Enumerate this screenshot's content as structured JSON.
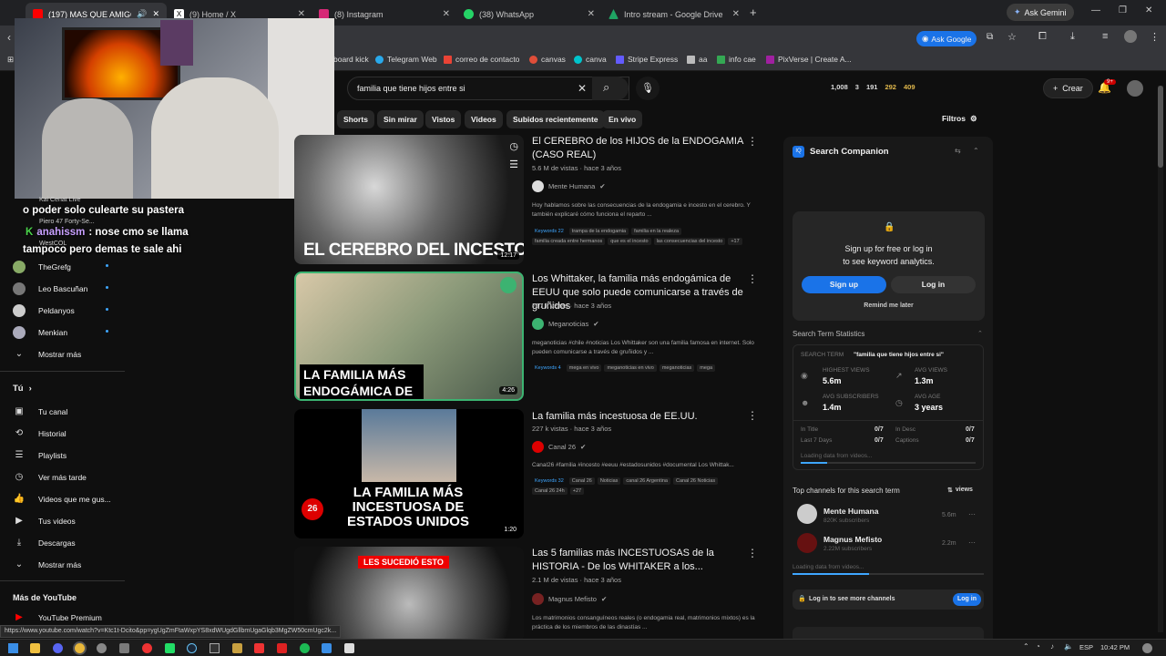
{
  "tabs": [
    {
      "title": "(197) MAS QUE AMIGOS | E",
      "color": "#ff0000"
    },
    {
      "title": "(9) Home / X",
      "color": "#ffffff"
    },
    {
      "title": "(8) Instagram",
      "color": "#d62976"
    },
    {
      "title": "(38) WhatsApp",
      "color": "#25d366"
    },
    {
      "title": "Intro stream - Google Drive",
      "color": "#1fa463"
    }
  ],
  "browser": {
    "ask_gemini": "Ask Gemini",
    "ask_google": "Ask Google"
  },
  "bookmarks": [
    "board kick",
    "Telegram Web",
    "correo de contacto",
    "canvas",
    "canva",
    "Stripe Express",
    "aa",
    "info cae",
    "PixVerse | Create A..."
  ],
  "search": {
    "query": "familia que tiene hijos entre si"
  },
  "header": {
    "stats": [
      "1,008",
      "3",
      "191",
      "292",
      "409"
    ],
    "create_label": "Crear",
    "notif_badge": "9+"
  },
  "chips": [
    "Shorts",
    "Sin mirar",
    "Vistos",
    "Videos",
    "Subidos recientemente",
    "En vivo"
  ],
  "filters_label": "Filtros",
  "chat": {
    "line1": "o poder solo culearte su pastera",
    "user2": "anahissm",
    "line2": ": nose cmo se llama",
    "line3": "tampoco pero demas te sale ahi",
    "under1": "Kai Cenat Live",
    "under2": "Piero 47 Forty-Se...",
    "under3": "WestCOL"
  },
  "sidebar": {
    "subs": [
      "TheGrefg",
      "Leo Bascuñan",
      "Peldanyos",
      "Menkian"
    ],
    "show_more": "Mostrar más",
    "you_label": "Tú",
    "you_items": [
      "Tu canal",
      "Historial",
      "Playlists",
      "Ver más tarde",
      "Videos que me gus...",
      "Tus videos",
      "Descargas",
      "Mostrar más"
    ],
    "more_label": "Más de YouTube",
    "premium": "YouTube Premium"
  },
  "videos": [
    {
      "title": "El CEREBRO de los HIJOS de la ENDOGAMIA (CASO REAL)",
      "meta": "5.6 M de vistas · hace 3 años",
      "channel": "Mente Humana",
      "desc": "Hoy hablamos sobre las consecuencias de la endogamia e incesto en el cerebro. Y también explicaré cómo funciona el reparto ...",
      "keywords": "Keywords 22",
      "tags": [
        "trampa de la endogamia",
        "familia en la realeza",
        "familia creada entre hermanos",
        "que es el incesto",
        "las consecuencias del incesto",
        "+17"
      ],
      "thumb_text": "EL CEREBRO DEL INCESTO",
      "duration": "12:17"
    },
    {
      "title": "Los Whittaker, la familia más endogámica de EEUU que solo puede comunicarse a través de gruñidos",
      "meta": "717 k vistas · hace 3 años",
      "channel": "Meganoticias",
      "desc": "meganoticias #chile #noticias Los Whittaker son una familia famosa en internet. Solo pueden comunicarse a través de gruñidos y ...",
      "keywords": "Keywords 4",
      "tags": [
        "mega en vivo",
        "meganoticias en vivo",
        "meganoticias",
        "mega"
      ],
      "thumb_text": "LA FAMILIA MÁS ENDOGÁMICA DE EE.UU",
      "duration": "4:26"
    },
    {
      "title": "La familia más incestuosa de EE.UU.",
      "meta": "227 k vistas · hace 3 años",
      "channel": "Canal 26",
      "desc": "Canal26 #familia #incesto #eeuu #estadosunidos #documental Los Whittak...",
      "keywords": "Keywords 32",
      "tags": [
        "Canal 26",
        "Noticias",
        "canal 26 Argentina",
        "Canal 26 Noticias",
        "Canal 26 24h",
        "+27"
      ],
      "thumb_text": "LA FAMILIA MÁS INCESTUOSA DE ESTADOS UNIDOS",
      "duration": "1:20"
    },
    {
      "title": "Las 5 familias más INCESTUOSAS de la HISTORIA - De los WHITAKER a los...",
      "meta": "2.1 M de vistas · hace 3 años",
      "channel": "Magnus Mefisto",
      "desc": "Los matrimonios consanguíneos reales (o endogamia real, matrimonios mixtos) es la práctica de los miembros de las dinastías ...",
      "thumb_text": "LES SUCEDIÓ ESTO"
    }
  ],
  "companion": {
    "title": "Search Companion",
    "signup_prompt1": "Sign up for free or log in",
    "signup_prompt2": "to see keyword analytics.",
    "signup": "Sign up",
    "login": "Log in",
    "remind": "Remind me later",
    "stats_title": "Search Term Statistics",
    "term_label": "SEARCH TERM",
    "term": "\"familia que tiene hijos entre si\"",
    "highest_views_label": "HIGHEST VIEWS",
    "highest_views": "5.6m",
    "avg_views_label": "AVG VIEWS",
    "avg_views": "1.3m",
    "avg_subs_label": "AVG SUBSCRIBERS",
    "avg_subs": "1.4m",
    "avg_age_label": "AVG AGE",
    "avg_age": "3 years",
    "in_title": "In Title",
    "in_title_v": "0/7",
    "in_desc": "In Desc",
    "in_desc_v": "0/7",
    "last7": "Last 7 Days",
    "last7_v": "0/7",
    "captions": "Captions",
    "captions_v": "0/7",
    "loading": "Loading data from videos...",
    "top_channels": "Top channels for this search term",
    "sort": "views",
    "channels": [
      {
        "name": "Mente Humana",
        "subs": "820K subscribers",
        "views": "5.6m"
      },
      {
        "name": "Magnus Mefisto",
        "subs": "2.22M subscribers",
        "views": "2.2m"
      }
    ],
    "loading2": "Loading data from videos...",
    "more_channels": "Log in to see more channels",
    "login_small": "Log in"
  },
  "status_url": "https://www.youtube.com/watch?v=Ktc1t-Dcito&pp=ygUgZmFtaWxpYS8xdWUgdGllbmUgaGlqb3MgZW50cmUgc2k...",
  "taskbar": {
    "lang": "ESP",
    "time": "10:42 PM"
  }
}
